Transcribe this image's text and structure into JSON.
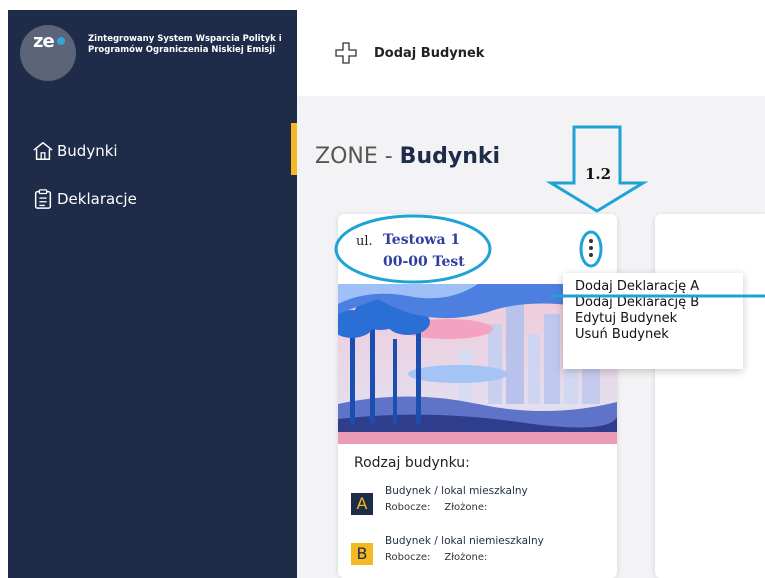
{
  "sidebar": {
    "logo_text": "ze",
    "org_name": "Zintegrowany System Wsparcia Polityk i Programów Ograniczenia Niskiej Emisji",
    "items": [
      {
        "label": "Budynki",
        "icon": "house-icon"
      },
      {
        "label": "Deklaracje",
        "icon": "clipboard-icon"
      }
    ]
  },
  "topbar": {
    "add_label": "Dodaj Budynek"
  },
  "main": {
    "title_prefix": "ZONE - ",
    "title_bold": "Budynki"
  },
  "card": {
    "addr_prefix": "ul.",
    "street": "Testowa 1",
    "code": "00-00 Test",
    "type_title": "Rodzaj budynku:",
    "types": [
      {
        "badge": "A",
        "name": "Budynek / lokal mieszkalny",
        "robocze": "Robocze:",
        "zlozone": "Złożone:"
      },
      {
        "badge": "B",
        "name": "Budynek / lokal niemieszkalny",
        "robocze": "Robocze:",
        "zlozone": "Złożone:"
      }
    ]
  },
  "menu": {
    "items": [
      "Dodaj Deklarację A",
      "Dodaj Deklarację B",
      "Edytuj Budynek",
      "Usuń Budynek"
    ]
  },
  "annotation": {
    "step": "1.2"
  },
  "colors": {
    "sidebar": "#1e2c49",
    "accent": "#f4b821",
    "annotation": "#1fa3d6"
  }
}
